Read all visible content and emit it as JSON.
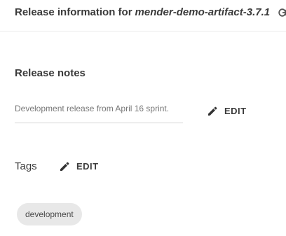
{
  "header": {
    "title_prefix": "Release information for",
    "release_name": "mender-demo-artifact-3.7.1",
    "link_icon": "link-icon"
  },
  "release_notes": {
    "heading": "Release notes",
    "value": "Development release from April 16 sprint.",
    "edit_label": "EDIT",
    "edit_icon": "pencil-icon"
  },
  "tags": {
    "heading": "Tags",
    "edit_label": "EDIT",
    "edit_icon": "pencil-icon",
    "items": [
      "development"
    ]
  }
}
